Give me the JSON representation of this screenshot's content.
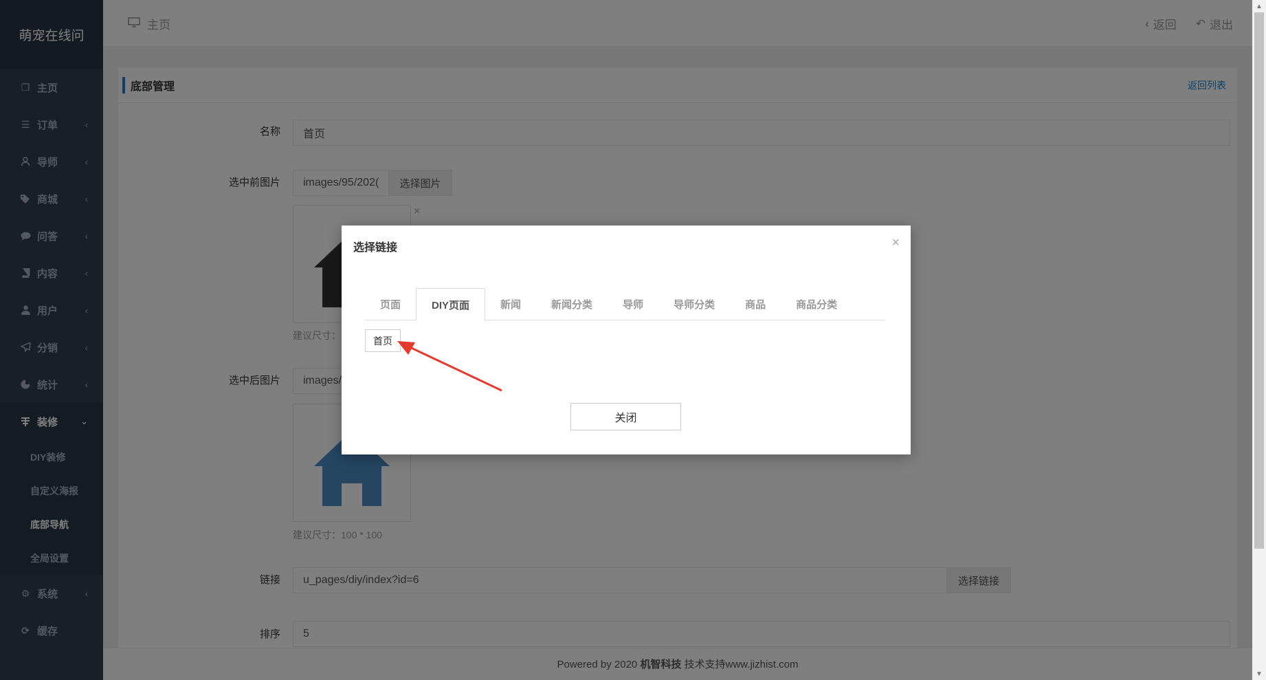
{
  "app": {
    "brand": "萌宠在线问"
  },
  "sidebar": {
    "items": [
      {
        "label": "主页",
        "icon": "copy-icon"
      },
      {
        "label": "订单",
        "icon": "list-icon"
      },
      {
        "label": "导师",
        "icon": "user-icon"
      },
      {
        "label": "商城",
        "icon": "tags-icon"
      },
      {
        "label": "问答",
        "icon": "comment-icon"
      },
      {
        "label": "内容",
        "icon": "book-icon"
      },
      {
        "label": "用户",
        "icon": "user-solid-icon"
      },
      {
        "label": "分销",
        "icon": "send-icon"
      },
      {
        "label": "统计",
        "icon": "pie-chart-icon"
      },
      {
        "label": "装修",
        "icon": "decoration-icon"
      }
    ],
    "sub_items": [
      {
        "label": "DIY装修"
      },
      {
        "label": "自定义海报"
      },
      {
        "label": "底部导航"
      },
      {
        "label": "全局设置"
      }
    ],
    "bottom_items": [
      {
        "label": "系统",
        "icon": "gear-icon"
      },
      {
        "label": "缓存",
        "icon": "refresh-icon"
      }
    ]
  },
  "topbar": {
    "home_label": "主页",
    "back_label": "返回",
    "logout_label": "退出"
  },
  "panel": {
    "title": "底部管理",
    "back_to_list": "返回列表",
    "form": {
      "name_label": "名称",
      "name_value": "首页",
      "before_image_label": "选中前图片",
      "before_image_value": "images/95/202(",
      "choose_image_label": "选择图片",
      "size_hint_1": "建议尺寸：",
      "after_image_label": "选中后图片",
      "after_image_value": "images/",
      "size_hint_2": "建议尺寸：100 * 100",
      "link_label": "链接",
      "link_value": "u_pages/diy/index?id=6",
      "choose_link_label": "选择链接",
      "sort_label": "排序",
      "sort_value": "5"
    }
  },
  "footer": {
    "prefix": "Powered by 2020 ",
    "company": "机智科技",
    "suffix": " 技术支持www.jizhist.com"
  },
  "modal": {
    "title": "选择链接",
    "tabs": [
      "页面",
      "DIY页面",
      "新闻",
      "新闻分类",
      "导师",
      "导师分类",
      "商品",
      "商品分类"
    ],
    "active_tab": "DIY页面",
    "link_item": "首页",
    "close_label": "关闭"
  },
  "colors": {
    "sidebar": "#2f4050",
    "accent": "#1c84c6",
    "arrow": "#e8392f",
    "house_dark": "#333333",
    "house_blue": "#4a8bc2"
  }
}
